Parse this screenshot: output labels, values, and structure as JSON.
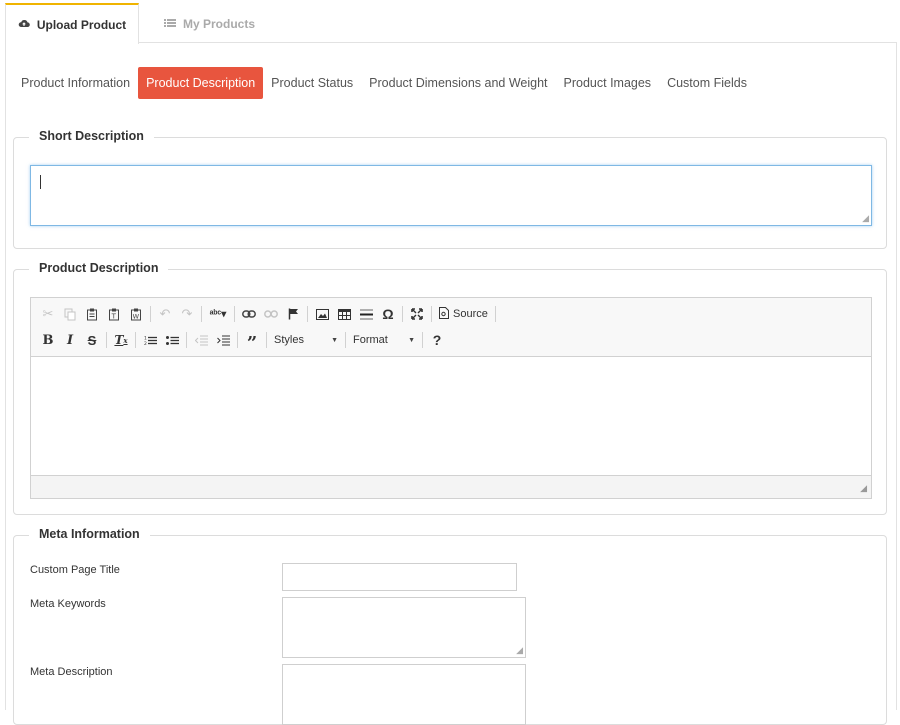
{
  "top_tabs": {
    "upload": "Upload Product",
    "my_products": "My Products"
  },
  "sub_tabs": [
    "Product Information",
    "Product Description",
    "Product Status",
    "Product Dimensions and Weight",
    "Product Images",
    "Custom Fields"
  ],
  "active_sub_tab": "Product Description",
  "short_description": {
    "legend": "Short Description",
    "value": ""
  },
  "product_description": {
    "legend": "Product Description",
    "toolbar": {
      "source_label": "Source",
      "styles_label": "Styles",
      "format_label": "Format"
    },
    "value": ""
  },
  "meta": {
    "legend": "Meta Information",
    "page_title_label": "Custom Page Title",
    "keywords_label": "Meta Keywords",
    "description_label": "Meta Description"
  },
  "colors": {
    "active_tab_accent": "#f0b400",
    "active_sub_tab_bg": "#e8553e"
  },
  "icons": {
    "upload": "cloud-upload-icon",
    "my_products": "list-icon"
  }
}
